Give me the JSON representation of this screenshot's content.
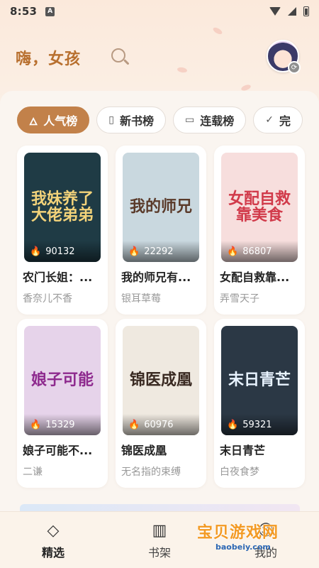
{
  "status_bar": {
    "time": "8:53",
    "a_badge": "A"
  },
  "header": {
    "greeting": "嗨，女孩"
  },
  "tabs": [
    {
      "label": "人气榜",
      "icon": "flame-icon",
      "active": true
    },
    {
      "label": "新书榜",
      "icon": "book-icon",
      "active": false
    },
    {
      "label": "连载榜",
      "icon": "bookmark-icon",
      "active": false
    },
    {
      "label": "完",
      "icon": "check-circle-icon",
      "active": false
    }
  ],
  "books": [
    {
      "title": "农门长姐：...",
      "author": "香奈儿不香",
      "heat": "90132",
      "cover_text": "我妹养了大佬弟弟",
      "cover_color": "#1f3b45",
      "cover_text_color": "#f3d37a"
    },
    {
      "title": "我的师兄有...",
      "author": "银耳草莓",
      "heat": "22292",
      "cover_text": "我的师兄",
      "cover_color": "#c9d8df",
      "cover_text_color": "#5a3a2a"
    },
    {
      "title": "女配自救靠...",
      "author": "弄雪天子",
      "heat": "86807",
      "cover_text": "女配自救靠美食",
      "cover_color": "#f7dedd",
      "cover_text_color": "#d13a4a"
    },
    {
      "title": "娘子可能不...",
      "author": "二谦",
      "heat": "15329",
      "cover_text": "娘子可能",
      "cover_color": "#e6d3ea",
      "cover_text_color": "#8e2a8e"
    },
    {
      "title": "锦医成凰",
      "author": "无名指的束缚",
      "heat": "60976",
      "cover_text": "锦医成凰",
      "cover_color": "#efe9e0",
      "cover_text_color": "#3a2a22"
    },
    {
      "title": "末日青芒",
      "author": "白夜食梦",
      "heat": "59321",
      "cover_text": "末日青芒",
      "cover_color": "#2b3845",
      "cover_text_color": "#e8f3ff"
    }
  ],
  "bottom_nav": [
    {
      "label": "精选",
      "icon": "diamond-icon",
      "active": true
    },
    {
      "label": "书架",
      "icon": "bookshelf-icon",
      "active": false
    },
    {
      "label": "我的",
      "icon": "user-icon",
      "active": false
    }
  ],
  "watermark": {
    "main": "宝贝游戏网",
    "sub": "baobeiy.com"
  }
}
